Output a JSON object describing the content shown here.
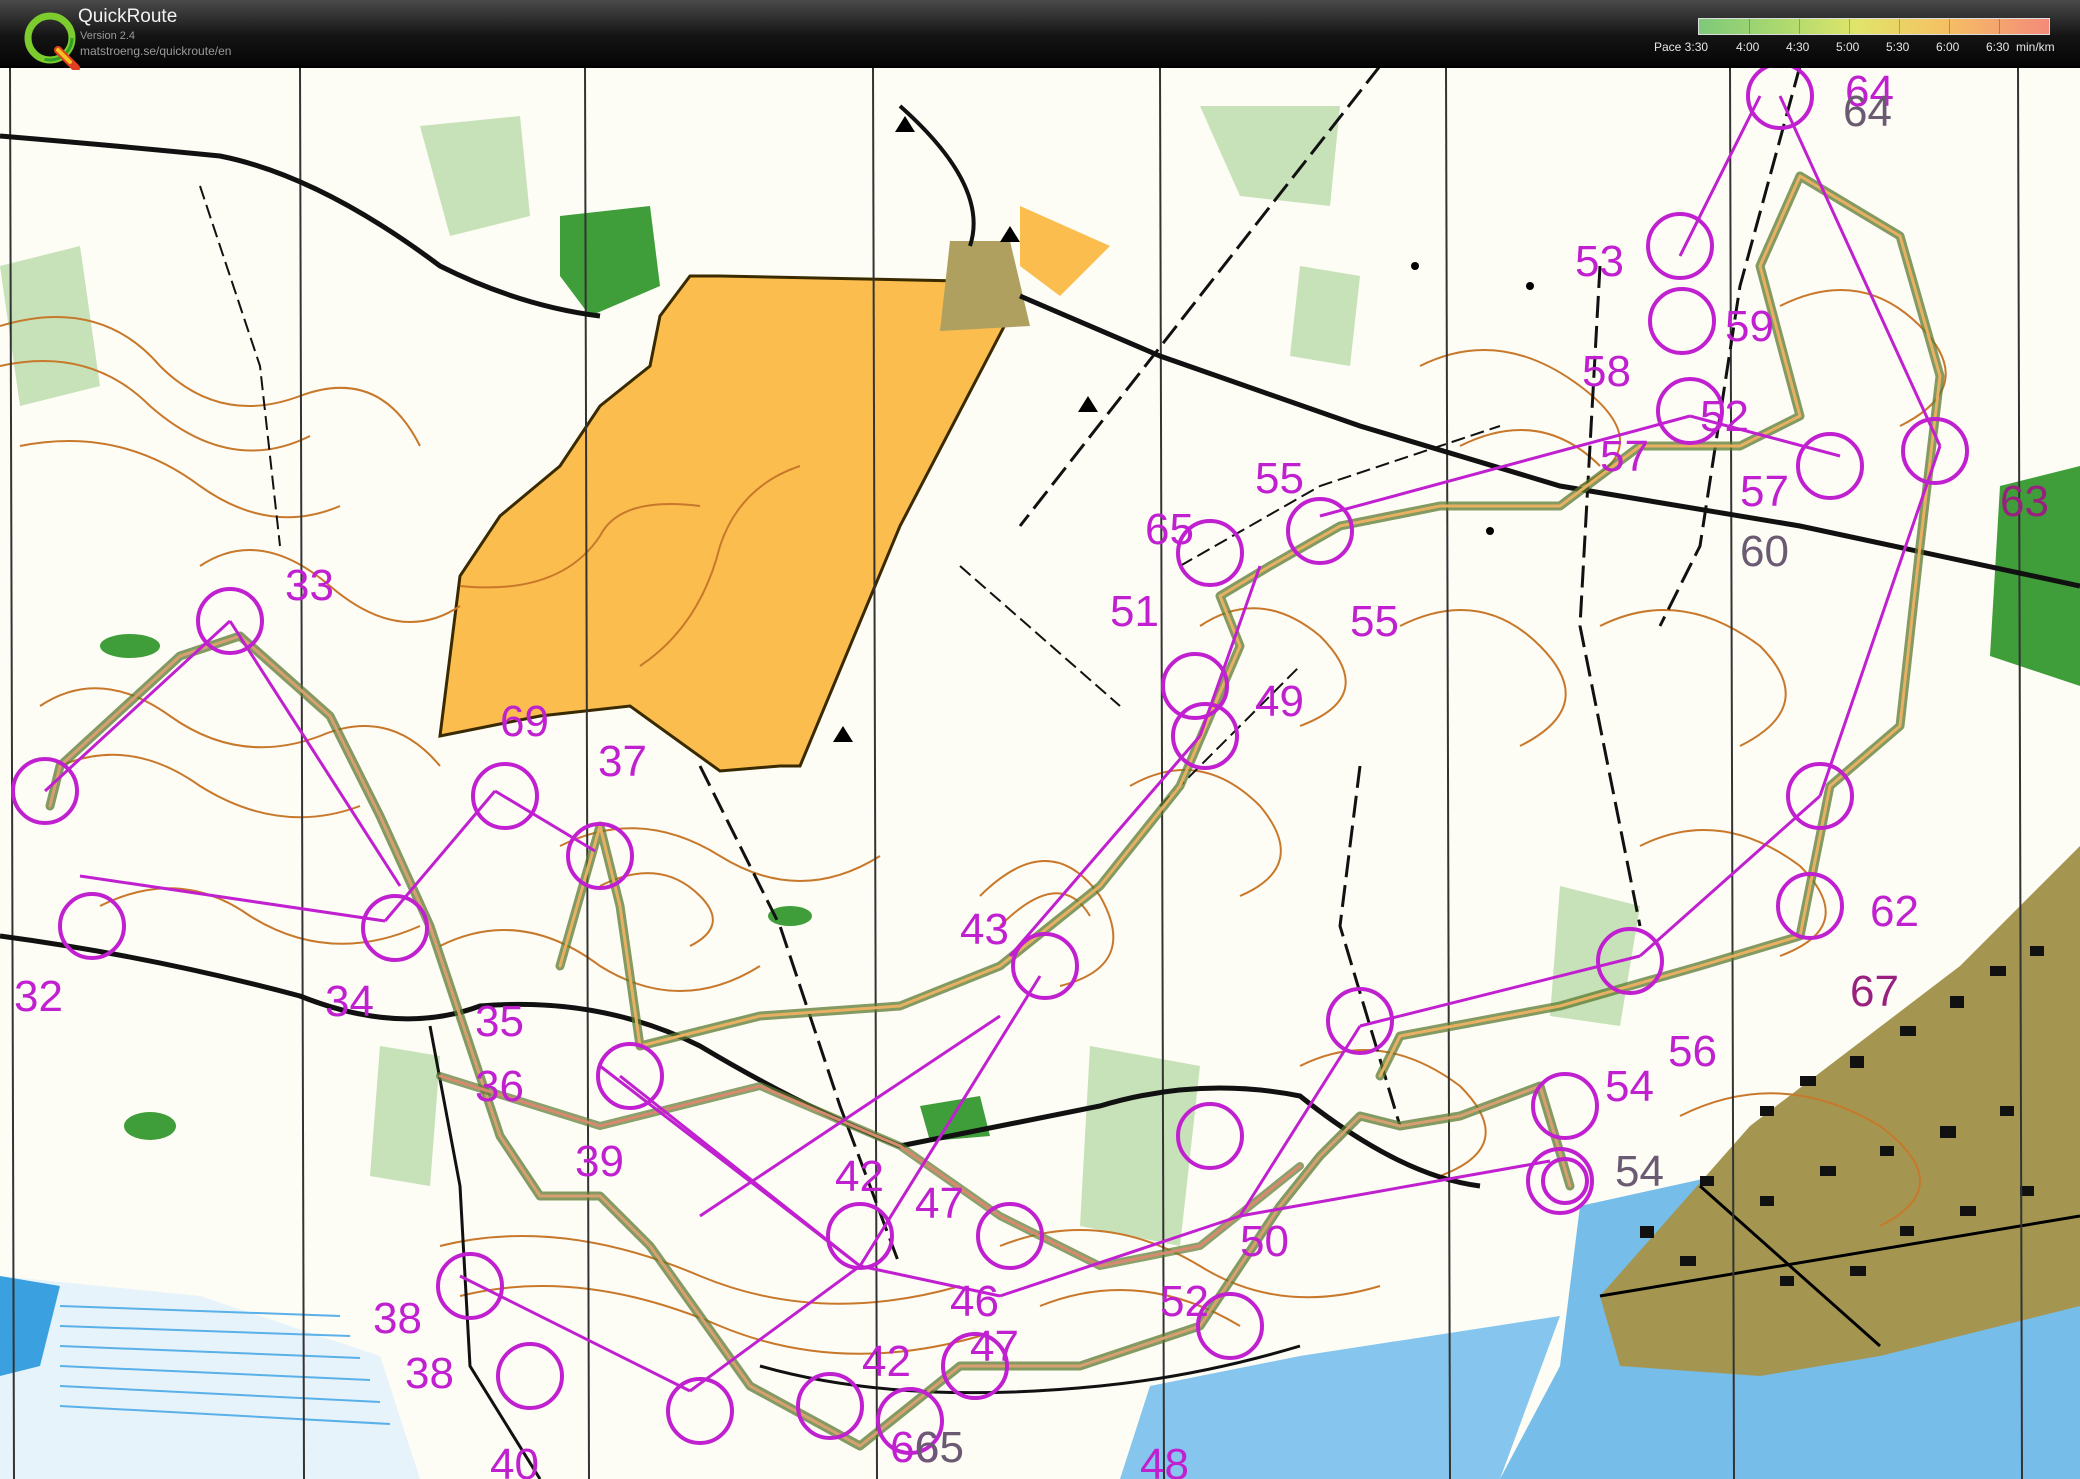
{
  "app": {
    "title": "QuickRoute",
    "version": "Version 2.4",
    "url": "matstroeng.se/quickroute/en"
  },
  "pace_legend": {
    "labels": [
      "Pace 3:30",
      "4:00",
      "4:30",
      "5:00",
      "5:30",
      "6:00",
      "6:30",
      "min/km"
    ],
    "gradient_colors": [
      "#7fc97a",
      "#a8d86f",
      "#e0e56a",
      "#f5c163",
      "#f48a7a"
    ]
  },
  "map": {
    "colors": {
      "control_purple": "#c020d0",
      "contour_brown": "#c8782a",
      "open_yellow": "#fbbd4e",
      "green_vegetation": "#3f9e3a",
      "light_green": "#c7e2b8",
      "urban_olive": "#a49650",
      "water_blue": "#6fb8ea",
      "route_line": "#6a8a3a"
    },
    "controls": [
      {
        "label": "33"
      },
      {
        "label": "32"
      },
      {
        "label": "34"
      },
      {
        "label": "69"
      },
      {
        "label": "37"
      },
      {
        "label": "35"
      },
      {
        "label": "36"
      },
      {
        "label": "39"
      },
      {
        "label": "38"
      },
      {
        "label": "38"
      },
      {
        "label": "40"
      },
      {
        "label": "43"
      },
      {
        "label": "42"
      },
      {
        "label": "47"
      },
      {
        "label": "46"
      },
      {
        "label": "42"
      },
      {
        "label": "47"
      },
      {
        "label": "66"
      },
      {
        "label": "65"
      },
      {
        "label": "50"
      },
      {
        "label": "52"
      },
      {
        "label": "48"
      },
      {
        "label": "65"
      },
      {
        "label": "51"
      },
      {
        "label": "49"
      },
      {
        "label": "55"
      },
      {
        "label": "55"
      },
      {
        "label": "53"
      },
      {
        "label": "59"
      },
      {
        "label": "58"
      },
      {
        "label": "52"
      },
      {
        "label": "57"
      },
      {
        "label": "57"
      },
      {
        "label": "60"
      },
      {
        "label": "64"
      },
      {
        "label": "64"
      },
      {
        "label": "63"
      },
      {
        "label": "62"
      },
      {
        "label": "67"
      },
      {
        "label": "56"
      },
      {
        "label": "54"
      },
      {
        "label": "54"
      }
    ]
  }
}
